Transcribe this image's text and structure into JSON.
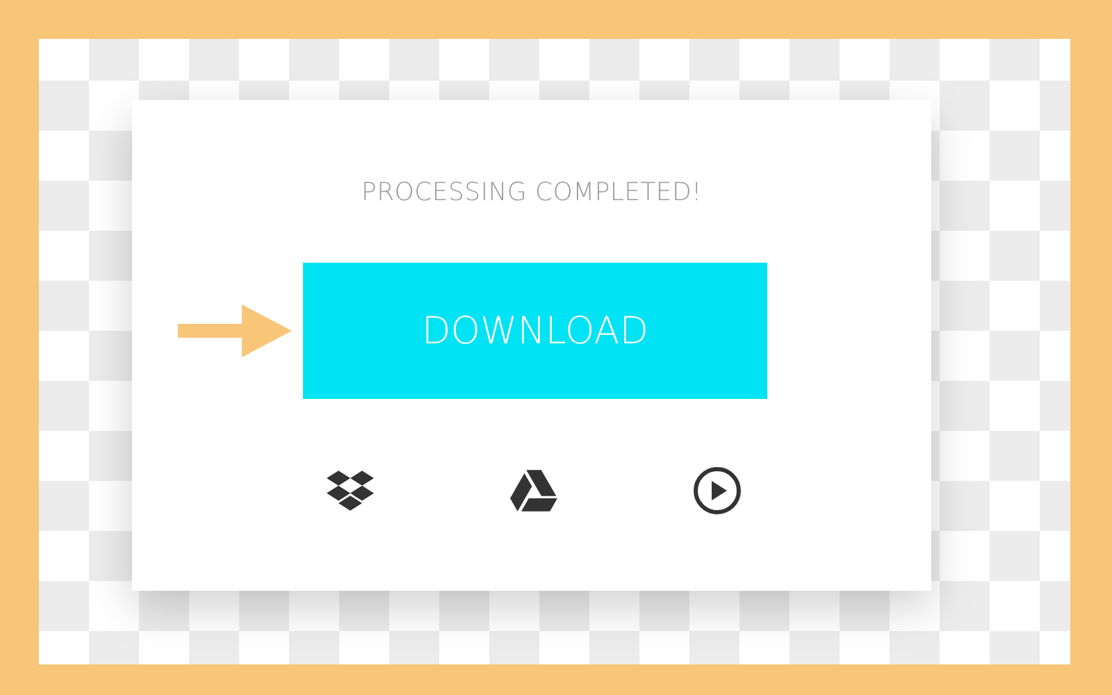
{
  "card": {
    "status": "PROCESSING COMPLETED!",
    "button": "DOWNLOAD"
  }
}
